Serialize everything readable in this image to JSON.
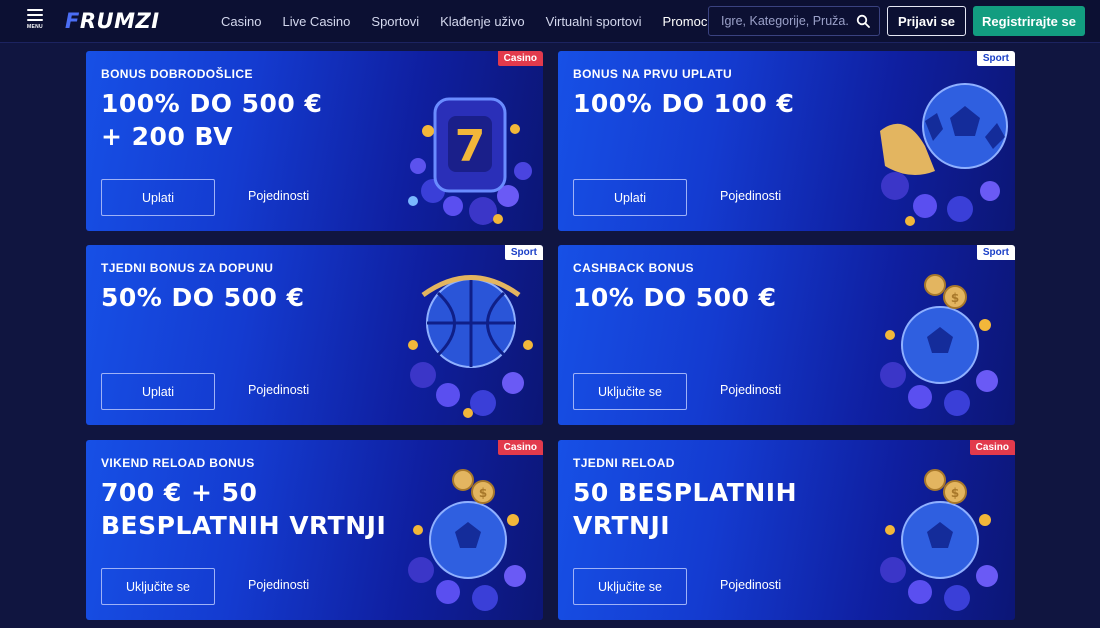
{
  "header": {
    "menu_label": "MENU",
    "logo_first": "F",
    "logo_rest": "RUMZI",
    "nav": [
      "Casino",
      "Live Casino",
      "Sportovi",
      "Klađenje uživo",
      "Virtualni sportovi",
      "Promocije"
    ],
    "search_placeholder": "Igre, Kategorije, Pruža...",
    "login_label": "Prijavi se",
    "register_label": "Registrirajte se"
  },
  "promos": [
    {
      "badge": "Casino",
      "subtitle": "BONUS DOBRODOŠLICE",
      "title": "100% DO 500 € + 200 BV",
      "cta": "Uplati",
      "details": "Pojedinosti",
      "art": "slot-machine-icon"
    },
    {
      "badge": "Sport",
      "subtitle": "BONUS NA PRVU UPLATU",
      "title": "100% DO 100 €",
      "cta": "Uplati",
      "details": "Pojedinosti",
      "art": "soccer-ball-boot-icon"
    },
    {
      "badge": "Sport",
      "subtitle": "TJEDNI BONUS ZA DOPUNU",
      "title": "50% DO 500 €",
      "cta": "Uplati",
      "details": "Pojedinosti",
      "art": "basketball-icon"
    },
    {
      "badge": "Sport",
      "subtitle": "CASHBACK BONUS",
      "title": "10% DO 500 €",
      "cta": "Uključite se",
      "details": "Pojedinosti",
      "art": "soccer-ball-coins-icon"
    },
    {
      "badge": "Casino",
      "subtitle": "VIKEND RELOAD BONUS",
      "title": "700 € + 50 BESPLATNIH VRTNJI",
      "cta": "Uključite se",
      "details": "Pojedinosti",
      "art": "soccer-ball-coins-icon"
    },
    {
      "badge": "Casino",
      "subtitle": "TJEDNI RELOAD",
      "title": "50 BESPLATNIH VRTNJI",
      "cta": "Uključite se",
      "details": "Pojedinosti",
      "art": "soccer-ball-coins-icon"
    }
  ],
  "colors": {
    "page_bg": "#101540",
    "card_gradient_start": "#1750e6",
    "casino_badge": "#e23a4c",
    "register_button": "#129d80"
  }
}
